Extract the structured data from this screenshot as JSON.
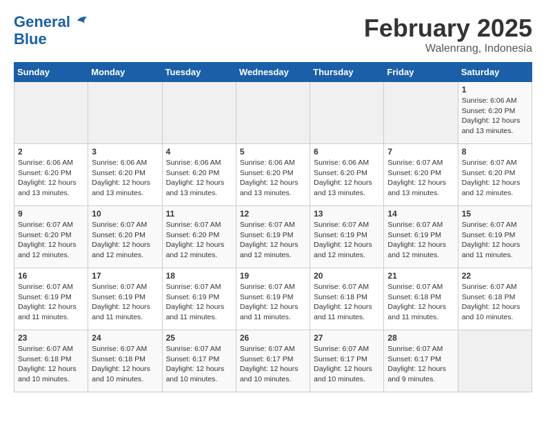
{
  "header": {
    "logo_line1": "General",
    "logo_line2": "Blue",
    "month_title": "February 2025",
    "subtitle": "Walenrang, Indonesia"
  },
  "days_of_week": [
    "Sunday",
    "Monday",
    "Tuesday",
    "Wednesday",
    "Thursday",
    "Friday",
    "Saturday"
  ],
  "weeks": [
    [
      {
        "day": "",
        "info": ""
      },
      {
        "day": "",
        "info": ""
      },
      {
        "day": "",
        "info": ""
      },
      {
        "day": "",
        "info": ""
      },
      {
        "day": "",
        "info": ""
      },
      {
        "day": "",
        "info": ""
      },
      {
        "day": "1",
        "info": "Sunrise: 6:06 AM\nSunset: 6:20 PM\nDaylight: 12 hours\nand 13 minutes."
      }
    ],
    [
      {
        "day": "2",
        "info": "Sunrise: 6:06 AM\nSunset: 6:20 PM\nDaylight: 12 hours\nand 13 minutes."
      },
      {
        "day": "3",
        "info": "Sunrise: 6:06 AM\nSunset: 6:20 PM\nDaylight: 12 hours\nand 13 minutes."
      },
      {
        "day": "4",
        "info": "Sunrise: 6:06 AM\nSunset: 6:20 PM\nDaylight: 12 hours\nand 13 minutes."
      },
      {
        "day": "5",
        "info": "Sunrise: 6:06 AM\nSunset: 6:20 PM\nDaylight: 12 hours\nand 13 minutes."
      },
      {
        "day": "6",
        "info": "Sunrise: 6:06 AM\nSunset: 6:20 PM\nDaylight: 12 hours\nand 13 minutes."
      },
      {
        "day": "7",
        "info": "Sunrise: 6:07 AM\nSunset: 6:20 PM\nDaylight: 12 hours\nand 13 minutes."
      },
      {
        "day": "8",
        "info": "Sunrise: 6:07 AM\nSunset: 6:20 PM\nDaylight: 12 hours\nand 12 minutes."
      }
    ],
    [
      {
        "day": "9",
        "info": "Sunrise: 6:07 AM\nSunset: 6:20 PM\nDaylight: 12 hours\nand 12 minutes."
      },
      {
        "day": "10",
        "info": "Sunrise: 6:07 AM\nSunset: 6:20 PM\nDaylight: 12 hours\nand 12 minutes."
      },
      {
        "day": "11",
        "info": "Sunrise: 6:07 AM\nSunset: 6:20 PM\nDaylight: 12 hours\nand 12 minutes."
      },
      {
        "day": "12",
        "info": "Sunrise: 6:07 AM\nSunset: 6:19 PM\nDaylight: 12 hours\nand 12 minutes."
      },
      {
        "day": "13",
        "info": "Sunrise: 6:07 AM\nSunset: 6:19 PM\nDaylight: 12 hours\nand 12 minutes."
      },
      {
        "day": "14",
        "info": "Sunrise: 6:07 AM\nSunset: 6:19 PM\nDaylight: 12 hours\nand 12 minutes."
      },
      {
        "day": "15",
        "info": "Sunrise: 6:07 AM\nSunset: 6:19 PM\nDaylight: 12 hours\nand 11 minutes."
      }
    ],
    [
      {
        "day": "16",
        "info": "Sunrise: 6:07 AM\nSunset: 6:19 PM\nDaylight: 12 hours\nand 11 minutes."
      },
      {
        "day": "17",
        "info": "Sunrise: 6:07 AM\nSunset: 6:19 PM\nDaylight: 12 hours\nand 11 minutes."
      },
      {
        "day": "18",
        "info": "Sunrise: 6:07 AM\nSunset: 6:19 PM\nDaylight: 12 hours\nand 11 minutes."
      },
      {
        "day": "19",
        "info": "Sunrise: 6:07 AM\nSunset: 6:19 PM\nDaylight: 12 hours\nand 11 minutes."
      },
      {
        "day": "20",
        "info": "Sunrise: 6:07 AM\nSunset: 6:18 PM\nDaylight: 12 hours\nand 11 minutes."
      },
      {
        "day": "21",
        "info": "Sunrise: 6:07 AM\nSunset: 6:18 PM\nDaylight: 12 hours\nand 11 minutes."
      },
      {
        "day": "22",
        "info": "Sunrise: 6:07 AM\nSunset: 6:18 PM\nDaylight: 12 hours\nand 10 minutes."
      }
    ],
    [
      {
        "day": "23",
        "info": "Sunrise: 6:07 AM\nSunset: 6:18 PM\nDaylight: 12 hours\nand 10 minutes."
      },
      {
        "day": "24",
        "info": "Sunrise: 6:07 AM\nSunset: 6:18 PM\nDaylight: 12 hours\nand 10 minutes."
      },
      {
        "day": "25",
        "info": "Sunrise: 6:07 AM\nSunset: 6:17 PM\nDaylight: 12 hours\nand 10 minutes."
      },
      {
        "day": "26",
        "info": "Sunrise: 6:07 AM\nSunset: 6:17 PM\nDaylight: 12 hours\nand 10 minutes."
      },
      {
        "day": "27",
        "info": "Sunrise: 6:07 AM\nSunset: 6:17 PM\nDaylight: 12 hours\nand 10 minutes."
      },
      {
        "day": "28",
        "info": "Sunrise: 6:07 AM\nSunset: 6:17 PM\nDaylight: 12 hours\nand 9 minutes."
      },
      {
        "day": "",
        "info": ""
      }
    ]
  ]
}
